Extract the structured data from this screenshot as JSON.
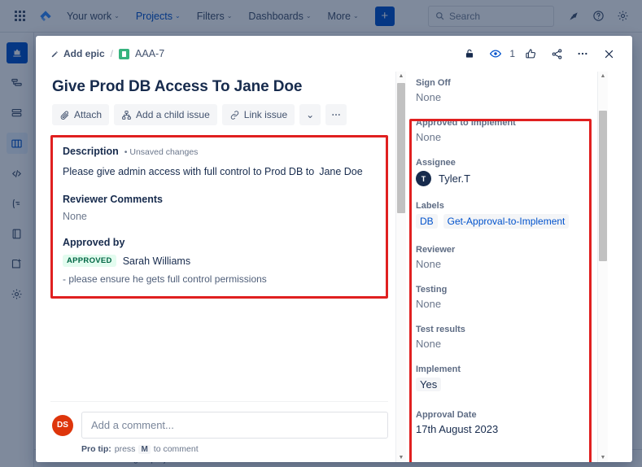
{
  "topnav": {
    "apps_icon": "apps-grid-icon",
    "logo_icon": "jira-logo-icon",
    "items": [
      {
        "label": "Your work",
        "caret": "⌄",
        "active": false
      },
      {
        "label": "Projects",
        "caret": "⌄",
        "active": true
      },
      {
        "label": "Filters",
        "caret": "⌄",
        "active": false
      },
      {
        "label": "Dashboards",
        "caret": "⌄",
        "active": false
      },
      {
        "label": "More",
        "caret": "⌄",
        "active": false
      }
    ],
    "create_label": "+",
    "search_placeholder": "Search",
    "notifications_icon": "notifications-bell-icon",
    "help_icon": "help-question-icon",
    "settings_icon": "settings-gear-icon"
  },
  "sidebar": {
    "items": [
      {
        "name": "project-avatar",
        "glyph": "♜"
      },
      {
        "name": "roadmap-icon",
        "glyph": "≣"
      },
      {
        "name": "backlog-icon",
        "glyph": "☲"
      },
      {
        "name": "board-icon",
        "glyph": "▦"
      },
      {
        "name": "code-icon",
        "glyph": "‹›"
      },
      {
        "name": "releases-icon",
        "glyph": "☎"
      },
      {
        "name": "pages-icon",
        "glyph": "☰"
      },
      {
        "name": "add-item-icon",
        "glyph": "⬚"
      },
      {
        "name": "project-settings-icon",
        "glyph": "⚙"
      }
    ]
  },
  "footer": {
    "text": "You're in a team-managed project"
  },
  "modal": {
    "breadcrumb": {
      "add_epic": "Add epic",
      "separator": "/",
      "issue_key": "AAA-7",
      "issue_type_icon": "story-green-icon"
    },
    "header_actions": {
      "lock_icon": "unlock-icon",
      "watch_icon": "watch-eye-icon",
      "watch_count": "1",
      "like_icon": "thumbs-up-icon",
      "share_icon": "share-icon",
      "more_icon": "more-actions-icon",
      "close_icon": "close-icon"
    },
    "title_main": "Give Prod DB Access To ",
    "title_bold": "Jane Doe",
    "buttons": [
      {
        "label": "Attach",
        "icon": "paperclip-icon"
      },
      {
        "label": "Add a child issue",
        "icon": "child-issue-icon"
      },
      {
        "label": "Link issue",
        "icon": "link-icon"
      }
    ],
    "buttons_caret": "⌄",
    "buttons_more": "•••",
    "description": {
      "label": "Description",
      "unsaved": "• Unsaved changes",
      "text": "Please give admin access with full control to Prod DB to",
      "name_mention": "Jane Doe"
    },
    "reviewer_comments": {
      "label": "Reviewer Comments",
      "value": "None"
    },
    "approved_by": {
      "label": "Approved by",
      "badge": "APPROVED",
      "approver": "Sarah Williams",
      "note": "- please ensure he gets full control permissions"
    },
    "comment": {
      "avatar_initials": "DS",
      "placeholder": "Add a comment...",
      "protip_prefix": "Pro tip:",
      "protip_mid": "press",
      "protip_key": "M",
      "protip_suffix": "to comment"
    },
    "fields": [
      {
        "label": "Sign Off",
        "value": "None",
        "kind": "none"
      },
      {
        "label": "Approved to Implement",
        "value": "None",
        "kind": "none"
      },
      {
        "label": "Assignee",
        "value": "Tyler.T",
        "kind": "assignee",
        "avatar_initial": "T"
      },
      {
        "label": "Labels",
        "kind": "labels",
        "chips": [
          "DB",
          "Get-Approval-to-Implement"
        ]
      },
      {
        "label": "Reviewer",
        "value": "None",
        "kind": "none"
      },
      {
        "label": "Testing",
        "value": "None",
        "kind": "none"
      },
      {
        "label": "Test results",
        "value": "None",
        "kind": "none"
      },
      {
        "label": "Implement",
        "value": "Yes",
        "kind": "pill"
      },
      {
        "label": "Approval Date",
        "value": "17th August 2023",
        "kind": "text"
      }
    ]
  },
  "colors": {
    "accent_blue": "#0052cc",
    "highlight_red": "#e02020",
    "approved_green_bg": "#e3fcef",
    "approved_green_text": "#006644",
    "avatar_red": "#de350b",
    "avatar_navy": "#172b4d",
    "issue_type_green": "#36b37e"
  }
}
